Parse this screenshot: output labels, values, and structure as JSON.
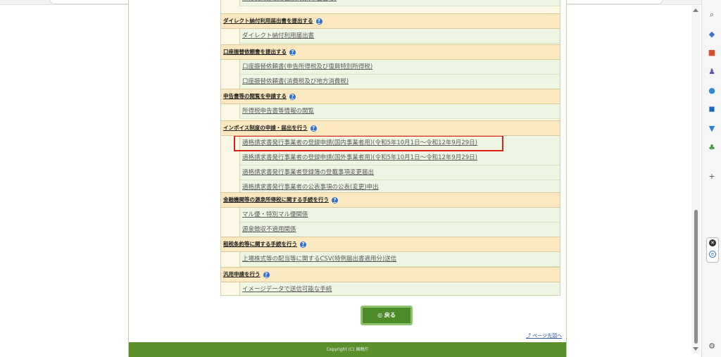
{
  "sections": [
    {
      "title": "ダイレクト納付利用届出書を提出する",
      "items": [
        "ダイレクト納付利用届出書"
      ]
    },
    {
      "title": "口座振替依頼書を提出する",
      "items": [
        "口座振替依頼書(申告所得税及び復興特別所得税)",
        "口座振替依頼書(消費税及び地方消費税)"
      ]
    },
    {
      "title": "申告書等の閲覧を申請する",
      "items": [
        "所得税申告書等情報の閲覧"
      ]
    },
    {
      "title": "インボイス制度の申請・届出を行う",
      "items": [
        "適格請求書発行事業者の登録申請(国内事業者用)(令和5年10月1日～令和12年9月29日)",
        "適格請求書発行事業者の登録申請(国外事業者用)(令和5年10月1日～令和12年9月29日)",
        "適格請求書発行事業者登録簿の登載事項変更届出",
        "適格請求書発行事業者の公表事項の公表(変更)申出"
      ]
    },
    {
      "title": "金融機関等の源泉所得税に関する手続を行う",
      "items": [
        "マル優・特別マル優関係",
        "源泉徴収不適用関係"
      ]
    },
    {
      "title": "租税条約等に関する手続を行う",
      "items": [
        "上場株式等の配当等に関するCSV(特例届出書適用分)送信"
      ]
    },
    {
      "title": "汎用申請を行う",
      "items": [
        "イメージデータで送信可能な手続"
      ]
    }
  ],
  "top_partial_text": "所得税関係帳簿書類関係(申告書等)",
  "back_button": "◎ 戻る",
  "page_top_link": "ページ先頭へ",
  "footer": "Copyright (C) 国税庁",
  "help_glyph": "?",
  "sidebar_icons": [
    "search-icon",
    "tag-icon",
    "toolbox-icon",
    "people-icon",
    "office-icon",
    "outlook-icon",
    "shopping-icon",
    "tree-icon",
    "plus-icon",
    "settings-icon"
  ],
  "colors": {
    "accent_green": "#5b8f2c",
    "highlight_red": "#e0201a",
    "help_blue": "#2f6fd6"
  }
}
